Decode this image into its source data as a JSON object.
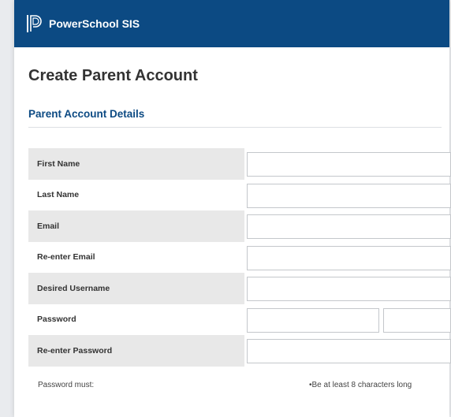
{
  "header": {
    "brand": "PowerSchool SIS",
    "logo_icon": "powerschool-p-logo-icon",
    "bar_color": "#0c4a83"
  },
  "page": {
    "title": "Create Parent Account"
  },
  "section": {
    "title": "Parent Account Details"
  },
  "form": {
    "fields": [
      {
        "label": "First Name",
        "value": ""
      },
      {
        "label": "Last Name",
        "value": ""
      },
      {
        "label": "Email",
        "value": ""
      },
      {
        "label": "Re-enter Email",
        "value": ""
      },
      {
        "label": "Desired Username",
        "value": ""
      },
      {
        "label": "Password",
        "value": ""
      },
      {
        "label": "Re-enter Password",
        "value": ""
      }
    ]
  },
  "password_requirements": {
    "label": "Password must:",
    "rules": [
      "•Be at least 8 characters long"
    ]
  }
}
